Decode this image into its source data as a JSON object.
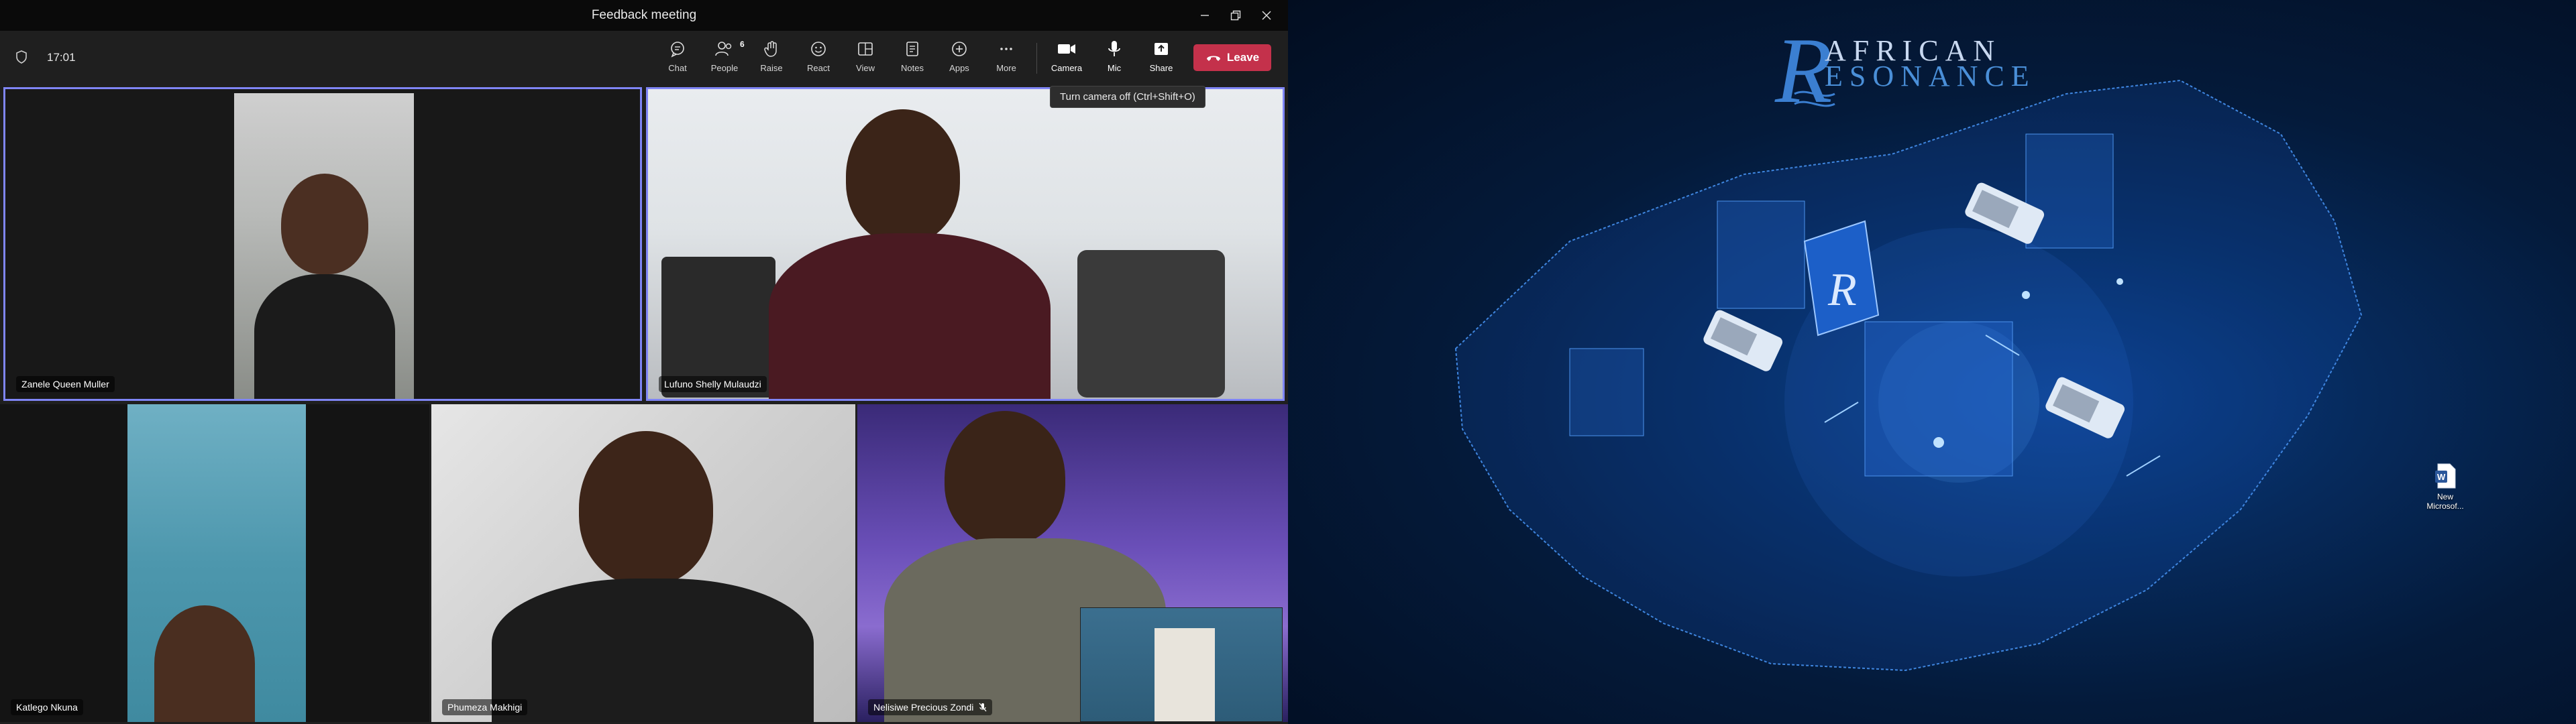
{
  "window": {
    "title": "Feedback meeting",
    "controls": {
      "minimize": "–",
      "maximize": "❐",
      "close": "✕"
    }
  },
  "toolbar": {
    "time": "17:01",
    "buttons": [
      {
        "label": "Chat",
        "icon": "chat-icon"
      },
      {
        "label": "People",
        "icon": "people-icon",
        "count": "6"
      },
      {
        "label": "Raise",
        "icon": "hand-icon"
      },
      {
        "label": "React",
        "icon": "smile-icon"
      },
      {
        "label": "View",
        "icon": "grid-view-icon"
      },
      {
        "label": "Notes",
        "icon": "notes-icon"
      },
      {
        "label": "Apps",
        "icon": "apps-icon"
      },
      {
        "label": "More",
        "icon": "more-icon"
      },
      {
        "label": "Camera",
        "icon": "camera-icon"
      },
      {
        "label": "Mic",
        "icon": "microphone-icon"
      },
      {
        "label": "Share",
        "icon": "share-icon"
      }
    ],
    "leave_label": "Leave",
    "tooltip": "Turn camera off (Ctrl+Shift+O)"
  },
  "participants": [
    {
      "name": "Zanele Queen Muller",
      "active": true
    },
    {
      "name": "Lufuno Shelly Mulaudzi",
      "active": true
    },
    {
      "name": "Katlego Nkuna",
      "active": false
    },
    {
      "name": "Phumeza Makhigi",
      "active": false
    },
    {
      "name": "Nelisiwe Precious Zondi",
      "active": false,
      "muted": true
    }
  ],
  "desktop": {
    "logo_line1": "AFRICAN",
    "logo_line2": "ESONANCE",
    "logo_initial": "R",
    "file": {
      "name_line1": "New",
      "name_line2": "Microsof...",
      "icon": "word-document-icon"
    }
  },
  "colors": {
    "accent": "#7f85f5",
    "leave": "#c4314b",
    "desktop_bg": "#062a5c"
  }
}
